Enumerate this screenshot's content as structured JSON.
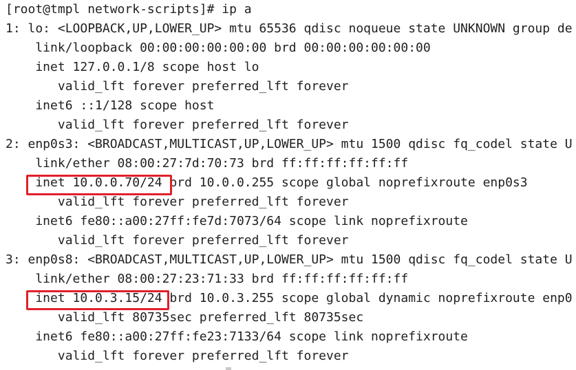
{
  "terminal": {
    "lines": [
      "[root@tmpl network-scripts]# ip a",
      "1: lo: <LOOPBACK,UP,LOWER_UP> mtu 65536 qdisc noqueue state UNKNOWN group de",
      "    link/loopback 00:00:00:00:00:00 brd 00:00:00:00:00:00",
      "    inet 127.0.0.1/8 scope host lo",
      "       valid_lft forever preferred_lft forever",
      "    inet6 ::1/128 scope host",
      "       valid_lft forever preferred_lft forever",
      "2: enp0s3: <BROADCAST,MULTICAST,UP,LOWER_UP> mtu 1500 qdisc fq_codel state U",
      "    link/ether 08:00:27:7d:70:73 brd ff:ff:ff:ff:ff:ff",
      "    inet 10.0.0.70/24 brd 10.0.0.255 scope global noprefixroute enp0s3",
      "       valid_lft forever preferred_lft forever",
      "    inet6 fe80::a00:27ff:fe7d:7073/64 scope link noprefixroute",
      "       valid_lft forever preferred_lft forever",
      "3: enp0s8: <BROADCAST,MULTICAST,UP,LOWER_UP> mtu 1500 qdisc fq_codel state U",
      "    link/ether 08:00:27:23:71:33 brd ff:ff:ff:ff:ff:ff",
      "    inet 10.0.3.15/24 brd 10.0.3.255 scope global dynamic noprefixroute enp0",
      "       valid_lft 80735sec preferred_lft 80735sec",
      "    inet6 fe80::a00:27ff:fe23:7133/64 scope link noprefixroute",
      "       valid_lft forever preferred_lft forever"
    ]
  },
  "highlights": {
    "color": "#e0202a",
    "items": [
      "inet 10.0.0.70/24",
      "inet 10.0.3.15/24"
    ]
  }
}
